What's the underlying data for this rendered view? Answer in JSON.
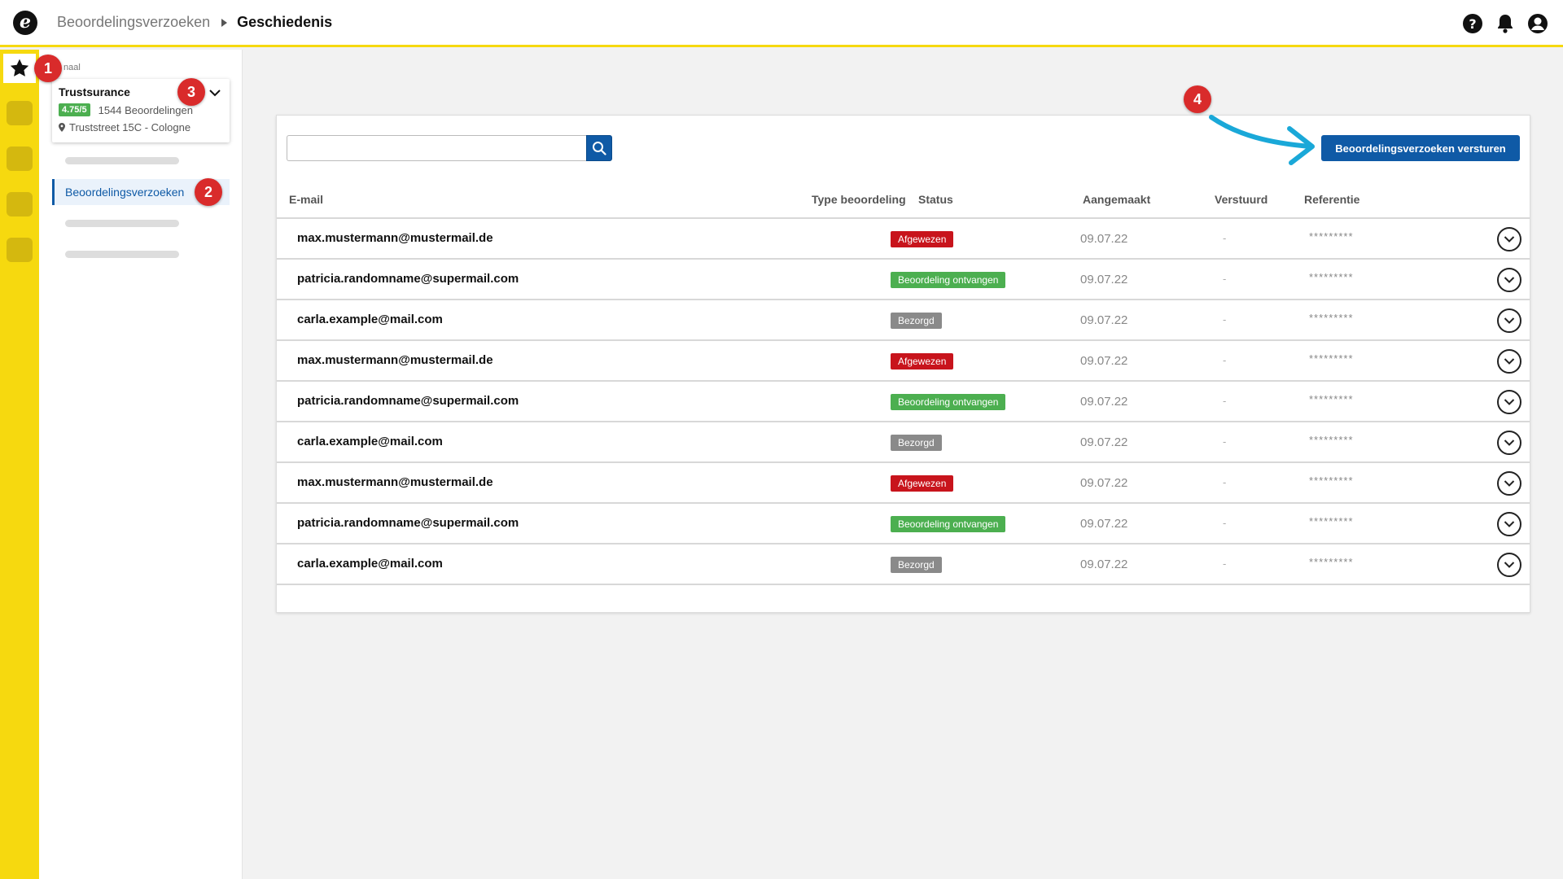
{
  "breadcrumb": {
    "parent": "Beoordelingsverzoeken",
    "current": "Geschiedenis"
  },
  "top_icons": [
    "help-icon",
    "bell-icon",
    "user-icon"
  ],
  "colors": {
    "accent_yellow": "#f6d90f",
    "primary_blue": "#0f5aa6",
    "status_red": "#c8141c",
    "status_green": "#4caf50",
    "status_grey": "#8a8a8a",
    "marker_red": "#d92b2b"
  },
  "sidebar": {
    "section_label": "naal",
    "company": {
      "name": "Trustsurance",
      "rating": "4.75/5",
      "review_count": "1544 Beoordelingen",
      "address": "Truststreet 15C - Cologne"
    },
    "active_item": "Beoordelingsverzoeken"
  },
  "markers": [
    "1",
    "2",
    "3",
    "4"
  ],
  "search": {
    "placeholder": ""
  },
  "send_button_label": "Beoordelingsverzoeken versturen",
  "table": {
    "headers": {
      "email": "E-mail",
      "type": "Type beoordeling",
      "status": "Status",
      "created": "Aangemaakt",
      "sent": "Verstuurd",
      "reference": "Referentie"
    },
    "rows": [
      {
        "email": "max.mustermann@mustermail.de",
        "status": "Afgewezen",
        "status_kind": "red",
        "created": "09.07.22",
        "sent": "-",
        "reference": "*********"
      },
      {
        "email": "patricia.randomname@supermail.com",
        "status": "Beoordeling ontvangen",
        "status_kind": "green",
        "created": "09.07.22",
        "sent": "-",
        "reference": "*********"
      },
      {
        "email": "carla.example@mail.com",
        "status": "Bezorgd",
        "status_kind": "grey",
        "created": "09.07.22",
        "sent": "-",
        "reference": "*********"
      },
      {
        "email": "max.mustermann@mustermail.de",
        "status": "Afgewezen",
        "status_kind": "red",
        "created": "09.07.22",
        "sent": "-",
        "reference": "*********"
      },
      {
        "email": "patricia.randomname@supermail.com",
        "status": "Beoordeling ontvangen",
        "status_kind": "green",
        "created": "09.07.22",
        "sent": "-",
        "reference": "*********"
      },
      {
        "email": "carla.example@mail.com",
        "status": "Bezorgd",
        "status_kind": "grey",
        "created": "09.07.22",
        "sent": "-",
        "reference": "*********"
      },
      {
        "email": "max.mustermann@mustermail.de",
        "status": "Afgewezen",
        "status_kind": "red",
        "created": "09.07.22",
        "sent": "-",
        "reference": "*********"
      },
      {
        "email": "patricia.randomname@supermail.com",
        "status": "Beoordeling ontvangen",
        "status_kind": "green",
        "created": "09.07.22",
        "sent": "-",
        "reference": "*********"
      },
      {
        "email": "carla.example@mail.com",
        "status": "Bezorgd",
        "status_kind": "grey",
        "created": "09.07.22",
        "sent": "-",
        "reference": "*********"
      }
    ]
  }
}
